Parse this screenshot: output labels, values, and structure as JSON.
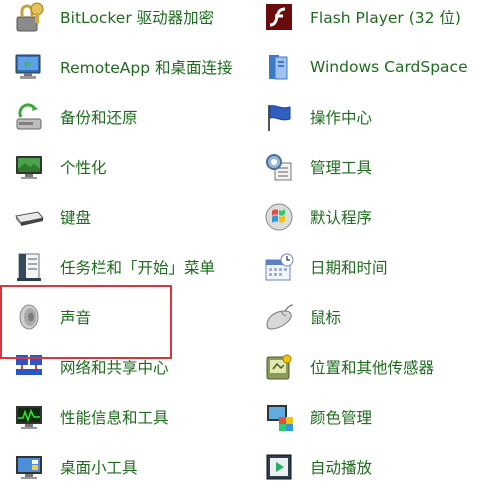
{
  "items_left": [
    {
      "label": "BitLocker 驱动器加密",
      "icon": "bitlocker-lock-icon"
    },
    {
      "label": "RemoteApp 和桌面连接",
      "icon": "remote-desktop-icon"
    },
    {
      "label": "备份和还原",
      "icon": "backup-restore-icon"
    },
    {
      "label": "个性化",
      "icon": "personalization-icon"
    },
    {
      "label": "键盘",
      "icon": "keyboard-icon"
    },
    {
      "label": "任务栏和「开始」菜单",
      "icon": "taskbar-start-icon"
    },
    {
      "label": "声音",
      "icon": "speaker-icon"
    },
    {
      "label": "网络和共享中心",
      "icon": "network-sharing-icon"
    },
    {
      "label": "性能信息和工具",
      "icon": "performance-icon"
    },
    {
      "label": "桌面小工具",
      "icon": "desktop-gadgets-icon"
    }
  ],
  "items_right": [
    {
      "label": "Flash Player (32 位)",
      "icon": "flash-player-icon"
    },
    {
      "label": "Windows CardSpace",
      "icon": "cardspace-icon"
    },
    {
      "label": "操作中心",
      "icon": "action-center-flag-icon"
    },
    {
      "label": "管理工具",
      "icon": "admin-tools-icon"
    },
    {
      "label": "默认程序",
      "icon": "default-programs-icon"
    },
    {
      "label": "日期和时间",
      "icon": "date-time-icon"
    },
    {
      "label": "鼠标",
      "icon": "mouse-icon"
    },
    {
      "label": "位置和其他传感器",
      "icon": "location-sensors-icon"
    },
    {
      "label": "颜色管理",
      "icon": "color-management-icon"
    },
    {
      "label": "自动播放",
      "icon": "autoplay-icon"
    }
  ],
  "colors": {
    "link": "#1e6b1e",
    "highlight_border": "#d9363e"
  }
}
